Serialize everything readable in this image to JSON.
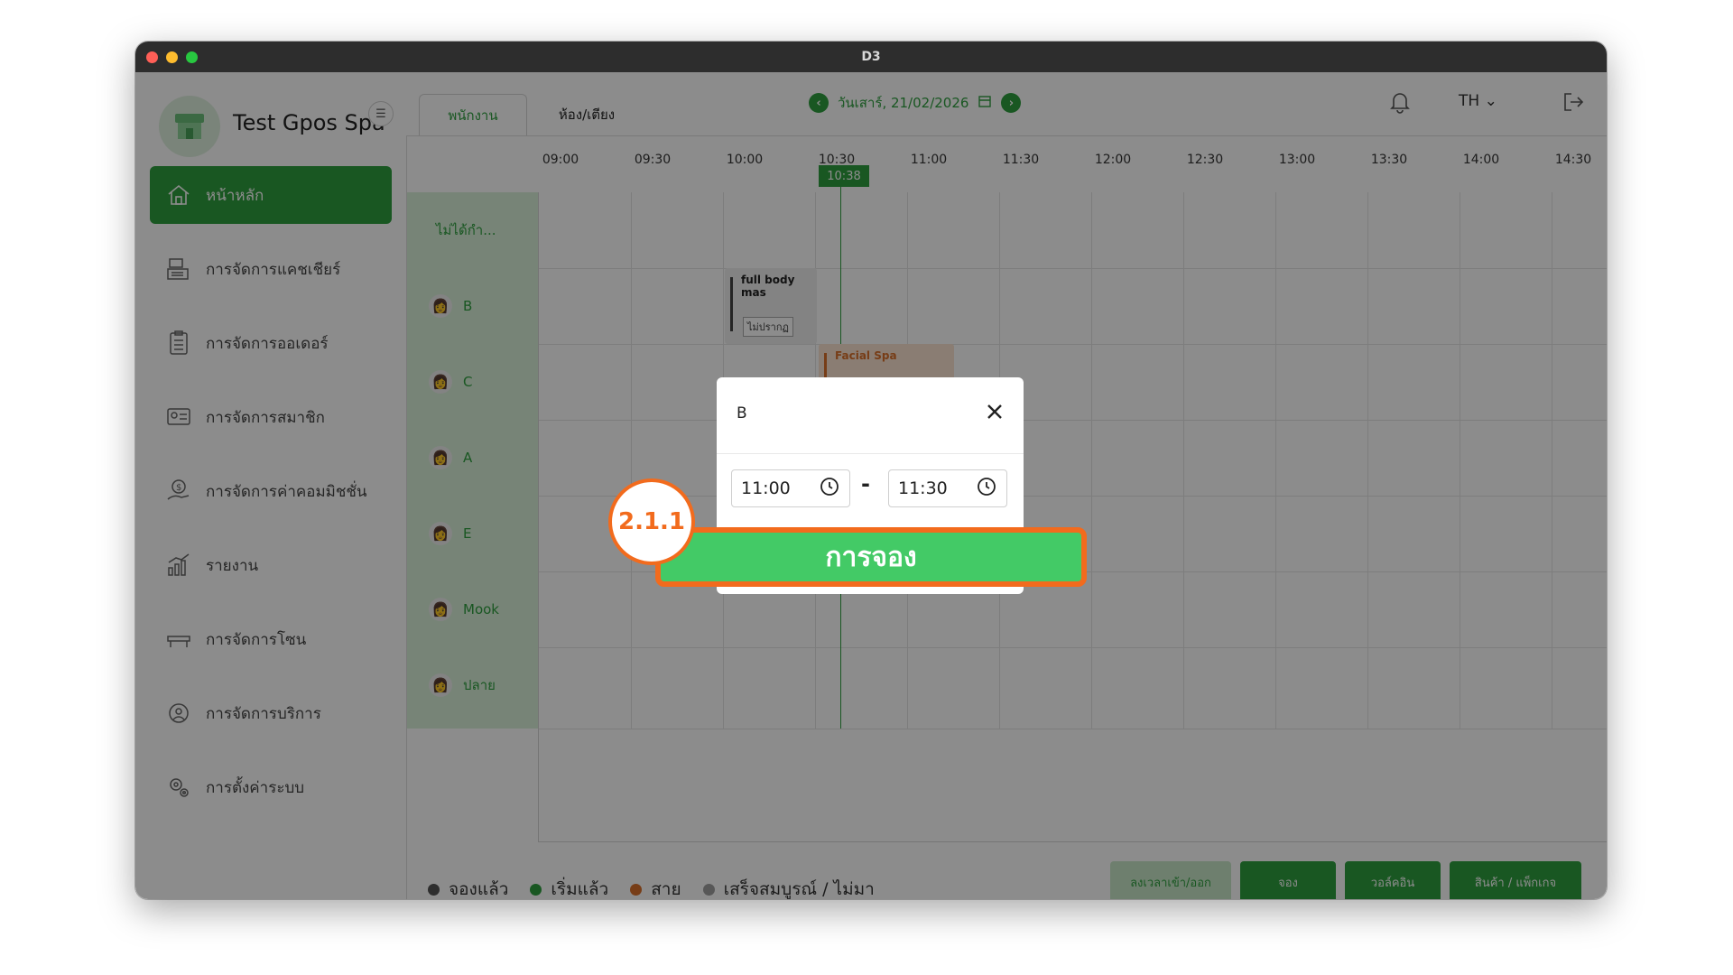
{
  "window": {
    "title": "D3"
  },
  "sidebar": {
    "shop_name": "Test Gpos Spa",
    "items": [
      {
        "label": "หน้าหลัก",
        "icon": "home-icon",
        "active": true
      },
      {
        "label": "การจัดการแคชเชียร์",
        "icon": "cashier-icon"
      },
      {
        "label": "การจัดการออเดอร์",
        "icon": "clipboard-icon"
      },
      {
        "label": "การจัดการสมาชิก",
        "icon": "member-card-icon"
      },
      {
        "label": "การจัดการค่าคอมมิชชั่น",
        "icon": "commission-icon"
      },
      {
        "label": "รายงาน",
        "icon": "report-chart-icon"
      },
      {
        "label": "การจัดการโซน",
        "icon": "bed-icon"
      },
      {
        "label": "การจัดการบริการ",
        "icon": "service-icon"
      },
      {
        "label": "การตั้งค่าระบบ",
        "icon": "settings-gear-icon"
      }
    ]
  },
  "header": {
    "tabs": [
      {
        "label": "พนักงาน",
        "active": true
      },
      {
        "label": "ห้อง/เตียง",
        "active": false
      }
    ],
    "date": "วันเสาร์, 21/02/2026",
    "lang": "TH"
  },
  "schedule": {
    "times": [
      "09:00",
      "09:30",
      "10:00",
      "10:30",
      "11:00",
      "11:30",
      "12:00",
      "12:30",
      "13:00",
      "13:30",
      "14:00",
      "14:30"
    ],
    "now": "10:38",
    "staff": [
      "ไม่ได้กำ...",
      "B",
      "C",
      "A",
      "E",
      "Mook",
      "ปลาย"
    ],
    "bookings": [
      {
        "title": "full body mas",
        "tag": "ไม่ปรากฏ"
      },
      {
        "title": "Facial Spa"
      }
    ]
  },
  "legend": [
    {
      "label": "จองแล้ว",
      "color": "#555555"
    },
    {
      "label": "เริ่มแล้ว",
      "color": "#2e9e3e"
    },
    {
      "label": "สาย",
      "color": "#d9702a"
    },
    {
      "label": "เสร็จสมบูรณ์ / ไม่มา",
      "color": "#9e9e9e"
    }
  ],
  "footer_buttons": [
    "ลงเวลาเข้า/ออก",
    "จอง",
    "วอล์คอิน",
    "สินค้า / แพ็กเกจ"
  ],
  "modal": {
    "title": "B",
    "start_time": "11:00",
    "end_time": "11:30",
    "dash": "-",
    "book_label": "การจอง"
  },
  "annotation": {
    "step": "2.1.1"
  },
  "colors": {
    "primary": "#2e9e3e",
    "accent": "#f26b1d",
    "book_button": "#43ca66"
  }
}
